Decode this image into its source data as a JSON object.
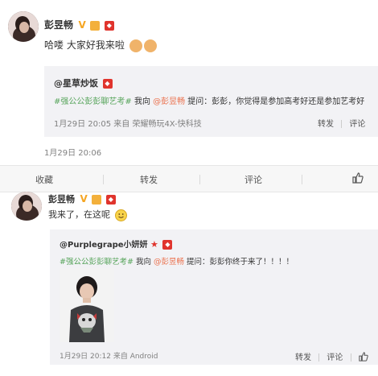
{
  "post1": {
    "author": "彭昱畅",
    "text": "哈喽 大家好我来啦",
    "time": "1月29日 20:06",
    "quote": {
      "author": "@星草炒饭",
      "topic": "#强公公彭彭聊艺考#",
      "text_mid": " 我向 ",
      "mention": "@彭昱畅",
      "text_end": " 提问：彭彭，你觉得是参加高考好还是参加艺考好",
      "meta": "1月29日 20:05 来自 荣耀畅玩4X-快科技",
      "repost": "转发",
      "comment": "评论"
    },
    "actions": {
      "fav": "收藏",
      "repost": "转发",
      "comment": "评论"
    }
  },
  "post2": {
    "author": "彭昱畅",
    "text": "我来了，在这呢",
    "quote": {
      "author": "@Purplegrape小妍妍",
      "topic": "#强公公彭彭聊艺考#",
      "text_mid": " 我向 ",
      "mention": "@彭昱畅",
      "text_end": " 提问：彭彭你终于来了！！！！",
      "meta": "1月29日 20:12 来自 Android",
      "repost": "转发",
      "comment": "评论"
    }
  },
  "colors": {
    "link": "#eb7350",
    "topic": "#58a55c",
    "card": "#f2f2f5"
  },
  "icons": [
    "like-icon",
    "v-badge-icon",
    "vip-badge-icon",
    "smile-emoji-icon"
  ]
}
